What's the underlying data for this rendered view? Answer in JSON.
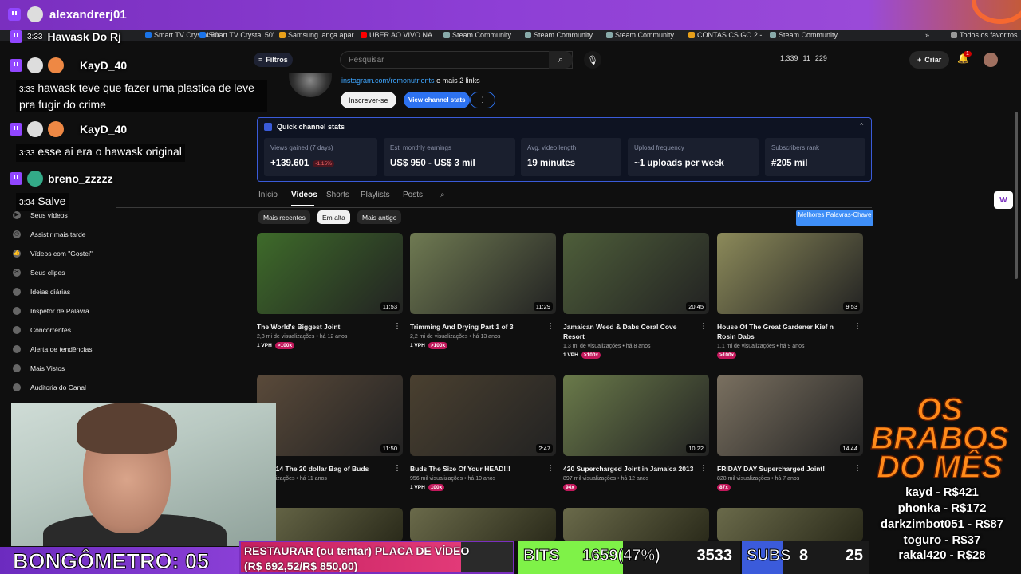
{
  "stream": {
    "username": "alexandrerj01"
  },
  "bookmarks": [
    {
      "label": "Smart TV Crystal 50'...",
      "color": "#1a73e8"
    },
    {
      "label": "Smart TV Crystal 50'...",
      "color": "#1a73e8"
    },
    {
      "label": "Samsung lança apar...",
      "color": "#e8a01a"
    },
    {
      "label": "UBER AO VIVO NA...",
      "color": "#ff0000"
    },
    {
      "label": "Steam Community...",
      "color": "#1b2838"
    },
    {
      "label": "Steam Community...",
      "color": "#1b2838"
    },
    {
      "label": "Steam Community...",
      "color": "#1b2838"
    },
    {
      "label": "CONTAS CS GO 2 -...",
      "color": "#e8a01a"
    },
    {
      "label": "Steam Community...",
      "color": "#1b2838"
    },
    {
      "label": "Todos os favoritos",
      "color": "#999999"
    }
  ],
  "header": {
    "filtros": "Filtros",
    "search_placeholder": "Pesquisar",
    "stat1": "1,339",
    "stat2": "11",
    "stat3": "229",
    "criar": "Criar",
    "notif": "1"
  },
  "chat": [
    {
      "time": "3:33",
      "user": "Hawask Do Rj",
      "msg": ""
    },
    {
      "time": "",
      "user": "KayD_40",
      "msg": ""
    },
    {
      "time": "3:33",
      "user": "",
      "msg": "hawask teve que fazer uma plastica de leve pra fugir do crime"
    },
    {
      "time": "",
      "user": "KayD_40",
      "msg": ""
    },
    {
      "time": "3:33",
      "user": "",
      "msg": "esse ai era o hawask original"
    },
    {
      "time": "",
      "user": "breno_zzzzz",
      "msg": ""
    },
    {
      "time": "3:34",
      "user": "",
      "msg": "Salve"
    }
  ],
  "sidebar": [
    {
      "label": "Seus vídeos",
      "icon": "play-icon"
    },
    {
      "label": "Assistir mais tarde",
      "icon": "clock-icon"
    },
    {
      "label": "Vídeos com \"Gostei\"",
      "icon": "thumbs-up-icon"
    },
    {
      "label": "Seus clipes",
      "icon": "scissors-icon"
    },
    {
      "label": "Ideias diárias",
      "icon": "bulb-icon"
    },
    {
      "label": "Inspetor de Palavra...",
      "icon": "search-icon"
    },
    {
      "label": "Concorrentes",
      "icon": "users-icon"
    },
    {
      "label": "Alerta de tendências",
      "icon": "bell-icon"
    },
    {
      "label": "Mais Vistos",
      "icon": "star-icon"
    },
    {
      "label": "Auditoria do Canal",
      "icon": "audit-icon"
    }
  ],
  "channel": {
    "link": "instagram.com/remonutrients",
    "more_links": "e mais 2 links",
    "subscribe": "Inscrever-se",
    "view_stats": "View channel stats"
  },
  "quick_stats": {
    "title": "Quick channel stats",
    "cards": [
      {
        "label": "Views gained (7 days)",
        "value": "+139.601",
        "delta": "-1.15%"
      },
      {
        "label": "Est. monthly earnings",
        "value": "US$ 950 - US$ 3 mil",
        "delta": ""
      },
      {
        "label": "Avg. video length",
        "value": "19 minutes",
        "delta": ""
      },
      {
        "label": "Upload frequency",
        "value": "~1 uploads per week",
        "delta": ""
      },
      {
        "label": "Subscribers rank",
        "value": "#205 mil",
        "delta": ""
      }
    ]
  },
  "tabs": [
    "Início",
    "Vídeos",
    "Shorts",
    "Playlists",
    "Posts"
  ],
  "chips": [
    "Mais recentes",
    "Em alta",
    "Mais antigo"
  ],
  "keywords_btn": "Melhores Palavras-Chave",
  "videos": [
    {
      "title": "The World's Biggest Joint",
      "views": "2,3 mi de visualizações",
      "age": "há 12 anos",
      "duration": "11:53",
      "vph": "1 VPH",
      "pct": ">100x",
      "thumb": "#3e6b2a"
    },
    {
      "title": "Trimming And Drying Part 1 of 3",
      "views": "2,2 mi de visualizações",
      "age": "há 13 anos",
      "duration": "11:29",
      "vph": "1 VPH",
      "pct": ">100x",
      "thumb": "#6f7a52"
    },
    {
      "title": "Jamaican Weed & Dabs Coral Cove Resort",
      "views": "1,3 mi de visualizações",
      "age": "há 8 anos",
      "duration": "20:45",
      "vph": "1 VPH",
      "pct": ">100x",
      "thumb": "#4e5e3a"
    },
    {
      "title": "House Of The Great Gardener Kief n Rosin Dabs",
      "views": "1,1 mi de visualizações",
      "age": "há 9 anos",
      "duration": "9:53",
      "vph": "",
      "pct": ">100x",
      "thumb": "#8c8a5a"
    },
    {
      "title": "ica 2014 The 20 dollar Bag of Buds",
      "views": "e visualizações",
      "age": "há 11 anos",
      "duration": "11:50",
      "vph": "",
      "pct": "",
      "thumb": "#5a4a3a"
    },
    {
      "title": "Buds The Size Of Your HEAD!!!",
      "views": "956 mil visualizações",
      "age": "há 10 anos",
      "duration": "2:47",
      "vph": "1 VPH",
      "pct": "100x",
      "thumb": "#4a4030"
    },
    {
      "title": "420 Supercharged Joint in Jamaica 2013",
      "views": "897 mil visualizações",
      "age": "há 12 anos",
      "duration": "10:22",
      "vph": "",
      "pct": "94x",
      "thumb": "#6a7a4a"
    },
    {
      "title": "FRIDAY DAY Supercharged Joint!",
      "views": "828 mil visualizações",
      "age": "há 7 anos",
      "duration": "14:44",
      "vph": "",
      "pct": "87x",
      "thumb": "#7a7060"
    }
  ],
  "webcam_label": "",
  "bongometro": "BONGÔMETRO: 05",
  "goal": {
    "line1": "RESTAURAR (ou tentar) PLACA DE VÍDEO",
    "line2": "(R$ 692,52/R$ 850,00)",
    "progress": 0.81
  },
  "bits": {
    "label": "BITS",
    "value": "1659(47%)",
    "goal": "3533",
    "progress": 0.47
  },
  "subs": {
    "label": "SUBS",
    "value": "8",
    "goal": "25",
    "progress": 0.32
  },
  "brabos": {
    "title": "OS BRABOS DO MÊS",
    "donors": [
      "kayd - R$421",
      "phonka - R$172",
      "darkzimbot051 - R$87",
      "toguro - R$37",
      "rakal420 - R$28"
    ]
  }
}
